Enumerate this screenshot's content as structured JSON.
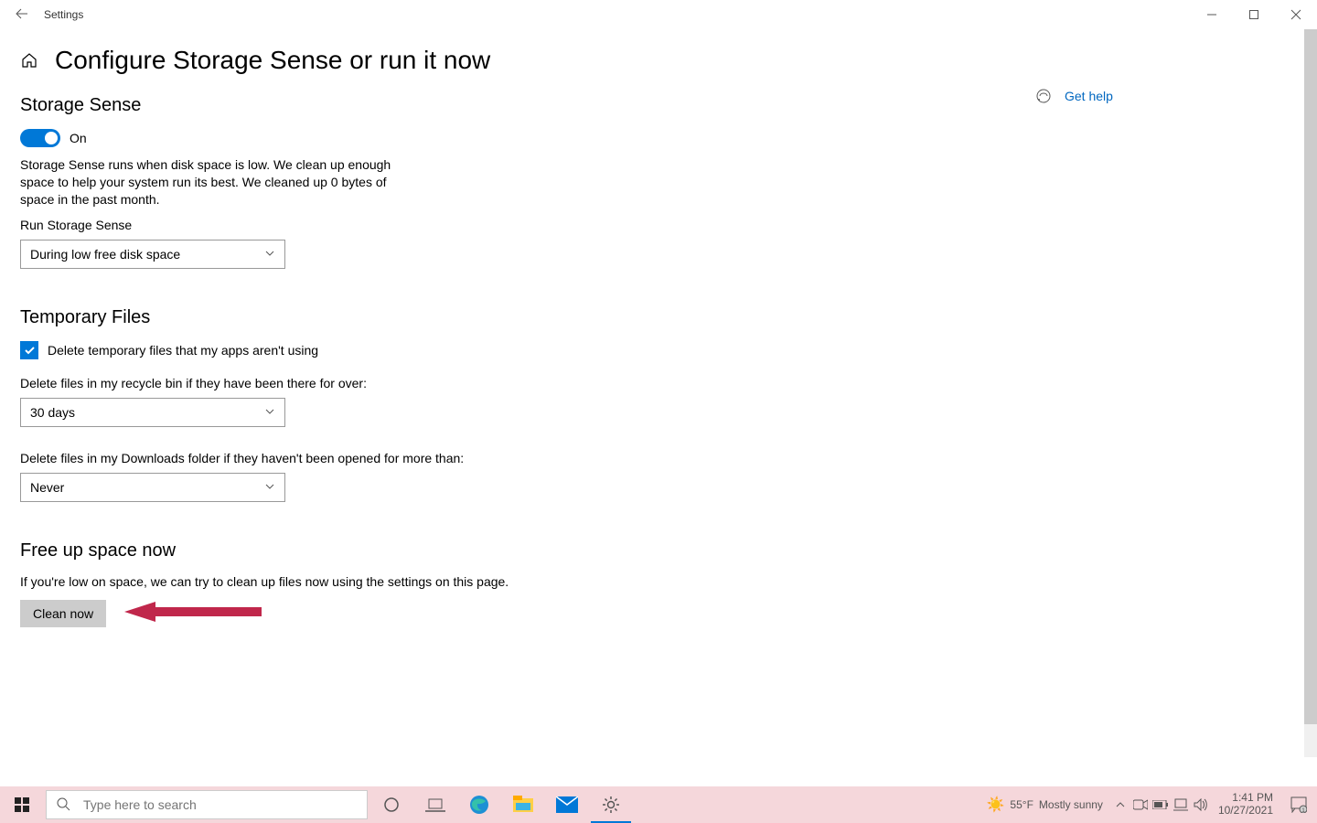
{
  "titlebar": {
    "app_name": "Settings"
  },
  "page": {
    "title": "Configure Storage Sense or run it now"
  },
  "storage_sense": {
    "heading": "Storage Sense",
    "toggle_state": "On",
    "description": "Storage Sense runs when disk space is low. We clean up enough space to help your system run its best. We cleaned up 0 bytes of space in the past month.",
    "run_label": "Run Storage Sense",
    "run_value": "During low free disk space"
  },
  "temp_files": {
    "heading": "Temporary Files",
    "delete_checkbox": "Delete temporary files that my apps aren't using",
    "recycle_label": "Delete files in my recycle bin if they have been there for over:",
    "recycle_value": "30 days",
    "downloads_label": "Delete files in my Downloads folder if they haven't been opened for more than:",
    "downloads_value": "Never"
  },
  "free_up": {
    "heading": "Free up space now",
    "description": "If you're low on space, we can try to clean up files now using the settings on this page.",
    "button": "Clean now"
  },
  "help": {
    "label": "Get help"
  },
  "taskbar": {
    "search_placeholder": "Type here to search",
    "weather_temp": "55°F",
    "weather_cond": "Mostly sunny",
    "time": "1:41 PM",
    "date": "10/27/2021"
  }
}
